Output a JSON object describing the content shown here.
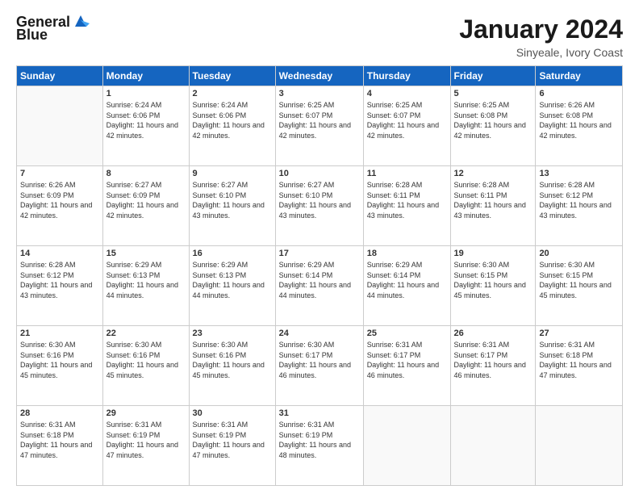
{
  "header": {
    "logo_line1": "General",
    "logo_line2": "Blue",
    "month": "January 2024",
    "location": "Sinyeale, Ivory Coast"
  },
  "weekdays": [
    "Sunday",
    "Monday",
    "Tuesday",
    "Wednesday",
    "Thursday",
    "Friday",
    "Saturday"
  ],
  "weeks": [
    [
      {
        "day": "",
        "sunrise": "",
        "sunset": "",
        "daylight": ""
      },
      {
        "day": "1",
        "sunrise": "Sunrise: 6:24 AM",
        "sunset": "Sunset: 6:06 PM",
        "daylight": "Daylight: 11 hours and 42 minutes."
      },
      {
        "day": "2",
        "sunrise": "Sunrise: 6:24 AM",
        "sunset": "Sunset: 6:06 PM",
        "daylight": "Daylight: 11 hours and 42 minutes."
      },
      {
        "day": "3",
        "sunrise": "Sunrise: 6:25 AM",
        "sunset": "Sunset: 6:07 PM",
        "daylight": "Daylight: 11 hours and 42 minutes."
      },
      {
        "day": "4",
        "sunrise": "Sunrise: 6:25 AM",
        "sunset": "Sunset: 6:07 PM",
        "daylight": "Daylight: 11 hours and 42 minutes."
      },
      {
        "day": "5",
        "sunrise": "Sunrise: 6:25 AM",
        "sunset": "Sunset: 6:08 PM",
        "daylight": "Daylight: 11 hours and 42 minutes."
      },
      {
        "day": "6",
        "sunrise": "Sunrise: 6:26 AM",
        "sunset": "Sunset: 6:08 PM",
        "daylight": "Daylight: 11 hours and 42 minutes."
      }
    ],
    [
      {
        "day": "7",
        "sunrise": "Sunrise: 6:26 AM",
        "sunset": "Sunset: 6:09 PM",
        "daylight": "Daylight: 11 hours and 42 minutes."
      },
      {
        "day": "8",
        "sunrise": "Sunrise: 6:27 AM",
        "sunset": "Sunset: 6:09 PM",
        "daylight": "Daylight: 11 hours and 42 minutes."
      },
      {
        "day": "9",
        "sunrise": "Sunrise: 6:27 AM",
        "sunset": "Sunset: 6:10 PM",
        "daylight": "Daylight: 11 hours and 43 minutes."
      },
      {
        "day": "10",
        "sunrise": "Sunrise: 6:27 AM",
        "sunset": "Sunset: 6:10 PM",
        "daylight": "Daylight: 11 hours and 43 minutes."
      },
      {
        "day": "11",
        "sunrise": "Sunrise: 6:28 AM",
        "sunset": "Sunset: 6:11 PM",
        "daylight": "Daylight: 11 hours and 43 minutes."
      },
      {
        "day": "12",
        "sunrise": "Sunrise: 6:28 AM",
        "sunset": "Sunset: 6:11 PM",
        "daylight": "Daylight: 11 hours and 43 minutes."
      },
      {
        "day": "13",
        "sunrise": "Sunrise: 6:28 AM",
        "sunset": "Sunset: 6:12 PM",
        "daylight": "Daylight: 11 hours and 43 minutes."
      }
    ],
    [
      {
        "day": "14",
        "sunrise": "Sunrise: 6:28 AM",
        "sunset": "Sunset: 6:12 PM",
        "daylight": "Daylight: 11 hours and 43 minutes."
      },
      {
        "day": "15",
        "sunrise": "Sunrise: 6:29 AM",
        "sunset": "Sunset: 6:13 PM",
        "daylight": "Daylight: 11 hours and 44 minutes."
      },
      {
        "day": "16",
        "sunrise": "Sunrise: 6:29 AM",
        "sunset": "Sunset: 6:13 PM",
        "daylight": "Daylight: 11 hours and 44 minutes."
      },
      {
        "day": "17",
        "sunrise": "Sunrise: 6:29 AM",
        "sunset": "Sunset: 6:14 PM",
        "daylight": "Daylight: 11 hours and 44 minutes."
      },
      {
        "day": "18",
        "sunrise": "Sunrise: 6:29 AM",
        "sunset": "Sunset: 6:14 PM",
        "daylight": "Daylight: 11 hours and 44 minutes."
      },
      {
        "day": "19",
        "sunrise": "Sunrise: 6:30 AM",
        "sunset": "Sunset: 6:15 PM",
        "daylight": "Daylight: 11 hours and 45 minutes."
      },
      {
        "day": "20",
        "sunrise": "Sunrise: 6:30 AM",
        "sunset": "Sunset: 6:15 PM",
        "daylight": "Daylight: 11 hours and 45 minutes."
      }
    ],
    [
      {
        "day": "21",
        "sunrise": "Sunrise: 6:30 AM",
        "sunset": "Sunset: 6:16 PM",
        "daylight": "Daylight: 11 hours and 45 minutes."
      },
      {
        "day": "22",
        "sunrise": "Sunrise: 6:30 AM",
        "sunset": "Sunset: 6:16 PM",
        "daylight": "Daylight: 11 hours and 45 minutes."
      },
      {
        "day": "23",
        "sunrise": "Sunrise: 6:30 AM",
        "sunset": "Sunset: 6:16 PM",
        "daylight": "Daylight: 11 hours and 45 minutes."
      },
      {
        "day": "24",
        "sunrise": "Sunrise: 6:30 AM",
        "sunset": "Sunset: 6:17 PM",
        "daylight": "Daylight: 11 hours and 46 minutes."
      },
      {
        "day": "25",
        "sunrise": "Sunrise: 6:31 AM",
        "sunset": "Sunset: 6:17 PM",
        "daylight": "Daylight: 11 hours and 46 minutes."
      },
      {
        "day": "26",
        "sunrise": "Sunrise: 6:31 AM",
        "sunset": "Sunset: 6:17 PM",
        "daylight": "Daylight: 11 hours and 46 minutes."
      },
      {
        "day": "27",
        "sunrise": "Sunrise: 6:31 AM",
        "sunset": "Sunset: 6:18 PM",
        "daylight": "Daylight: 11 hours and 47 minutes."
      }
    ],
    [
      {
        "day": "28",
        "sunrise": "Sunrise: 6:31 AM",
        "sunset": "Sunset: 6:18 PM",
        "daylight": "Daylight: 11 hours and 47 minutes."
      },
      {
        "day": "29",
        "sunrise": "Sunrise: 6:31 AM",
        "sunset": "Sunset: 6:19 PM",
        "daylight": "Daylight: 11 hours and 47 minutes."
      },
      {
        "day": "30",
        "sunrise": "Sunrise: 6:31 AM",
        "sunset": "Sunset: 6:19 PM",
        "daylight": "Daylight: 11 hours and 47 minutes."
      },
      {
        "day": "31",
        "sunrise": "Sunrise: 6:31 AM",
        "sunset": "Sunset: 6:19 PM",
        "daylight": "Daylight: 11 hours and 48 minutes."
      },
      {
        "day": "",
        "sunrise": "",
        "sunset": "",
        "daylight": ""
      },
      {
        "day": "",
        "sunrise": "",
        "sunset": "",
        "daylight": ""
      },
      {
        "day": "",
        "sunrise": "",
        "sunset": "",
        "daylight": ""
      }
    ]
  ]
}
